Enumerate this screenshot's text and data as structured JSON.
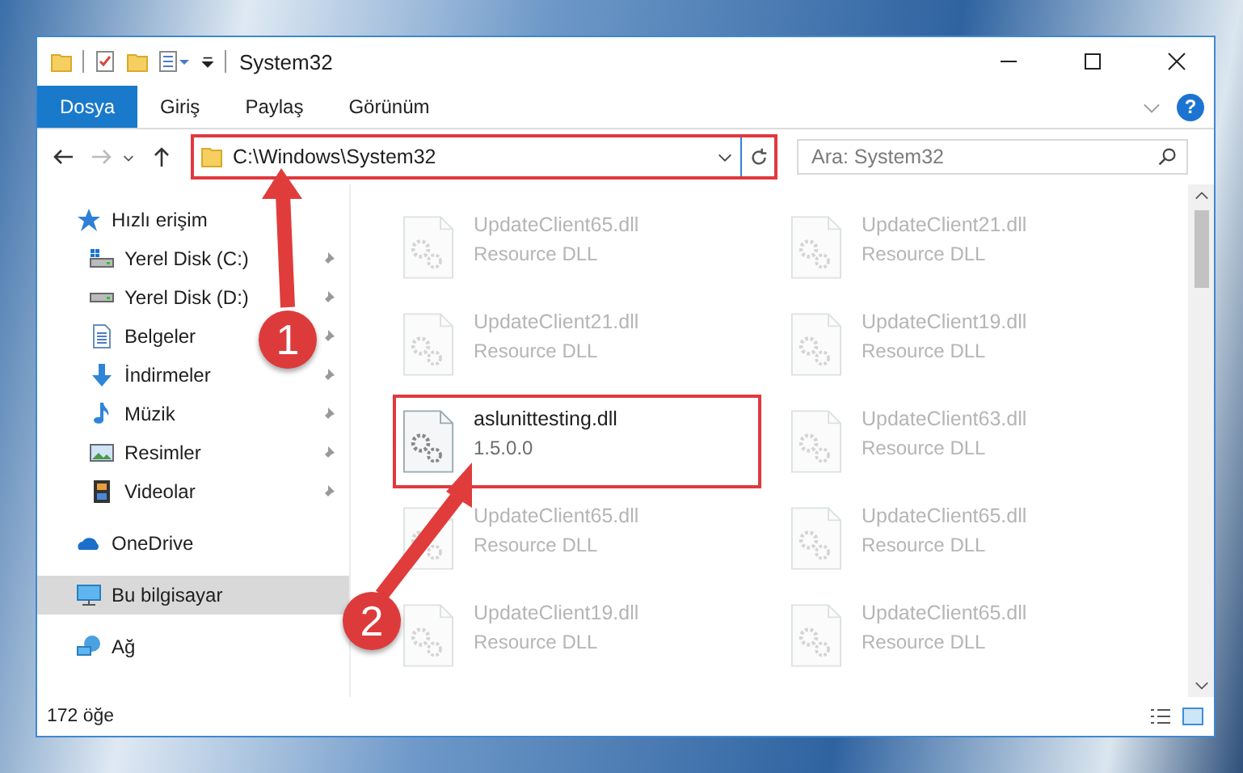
{
  "window": {
    "title": "System32"
  },
  "ribbon": {
    "tabs": [
      {
        "label": "Dosya",
        "selected": true
      },
      {
        "label": "Giriş",
        "selected": false
      },
      {
        "label": "Paylaş",
        "selected": false
      },
      {
        "label": "Görünüm",
        "selected": false
      }
    ]
  },
  "address": {
    "path": "C:\\Windows\\System32",
    "highlighted": true
  },
  "search": {
    "placeholder": "Ara: System32"
  },
  "help": {
    "label": "?"
  },
  "sidebar": {
    "items": [
      {
        "label": "Hızlı erişim",
        "kind": "star",
        "selected": false,
        "children": [
          {
            "label": "Yerel Disk (C:)",
            "kind": "system-drive",
            "pinned": true,
            "selected": false
          },
          {
            "label": "Yerel Disk (D:)",
            "kind": "drive",
            "pinned": true,
            "selected": false
          },
          {
            "label": "Belgeler",
            "kind": "document",
            "pinned": true,
            "selected": false
          },
          {
            "label": "İndirmeler",
            "kind": "download",
            "pinned": true,
            "selected": false
          },
          {
            "label": "Müzik",
            "kind": "music",
            "pinned": true,
            "selected": false
          },
          {
            "label": "Resimler",
            "kind": "picture",
            "pinned": true,
            "selected": false
          },
          {
            "label": "Videolar",
            "kind": "video",
            "pinned": true,
            "selected": false
          }
        ]
      },
      {
        "label": "OneDrive",
        "kind": "cloud",
        "selected": false
      },
      {
        "label": "Bu bilgisayar",
        "kind": "pc",
        "selected": true
      },
      {
        "label": "Ağ",
        "kind": "network",
        "selected": false
      }
    ]
  },
  "files": [
    {
      "name": "UpdateClient65.dll",
      "detail": "Resource DLL",
      "faded": true,
      "highlighted": false
    },
    {
      "name": "UpdateClient21.dll",
      "detail": "Resource DLL",
      "faded": true,
      "highlighted": false
    },
    {
      "name": "UpdateClient21.dll",
      "detail": "Resource DLL",
      "faded": true,
      "highlighted": false
    },
    {
      "name": "UpdateClient19.dll",
      "detail": "Resource DLL",
      "faded": true,
      "highlighted": false
    },
    {
      "name": "aslunittesting.dll",
      "detail": "1.5.0.0",
      "faded": false,
      "highlighted": true
    },
    {
      "name": "UpdateClient63.dll",
      "detail": "Resource DLL",
      "faded": true,
      "highlighted": false
    },
    {
      "name": "UpdateClient65.dll",
      "detail": "Resource DLL",
      "faded": true,
      "highlighted": false
    },
    {
      "name": "UpdateClient65.dll",
      "detail": "Resource DLL",
      "faded": true,
      "highlighted": false
    },
    {
      "name": "UpdateClient19.dll",
      "detail": "Resource DLL",
      "faded": true,
      "highlighted": false
    },
    {
      "name": "UpdateClient65.dll",
      "detail": "Resource DLL",
      "faded": true,
      "highlighted": false
    }
  ],
  "status_bar": {
    "count": "172 öğe"
  },
  "annotations": [
    {
      "number": "1"
    },
    {
      "number": "2"
    }
  ]
}
